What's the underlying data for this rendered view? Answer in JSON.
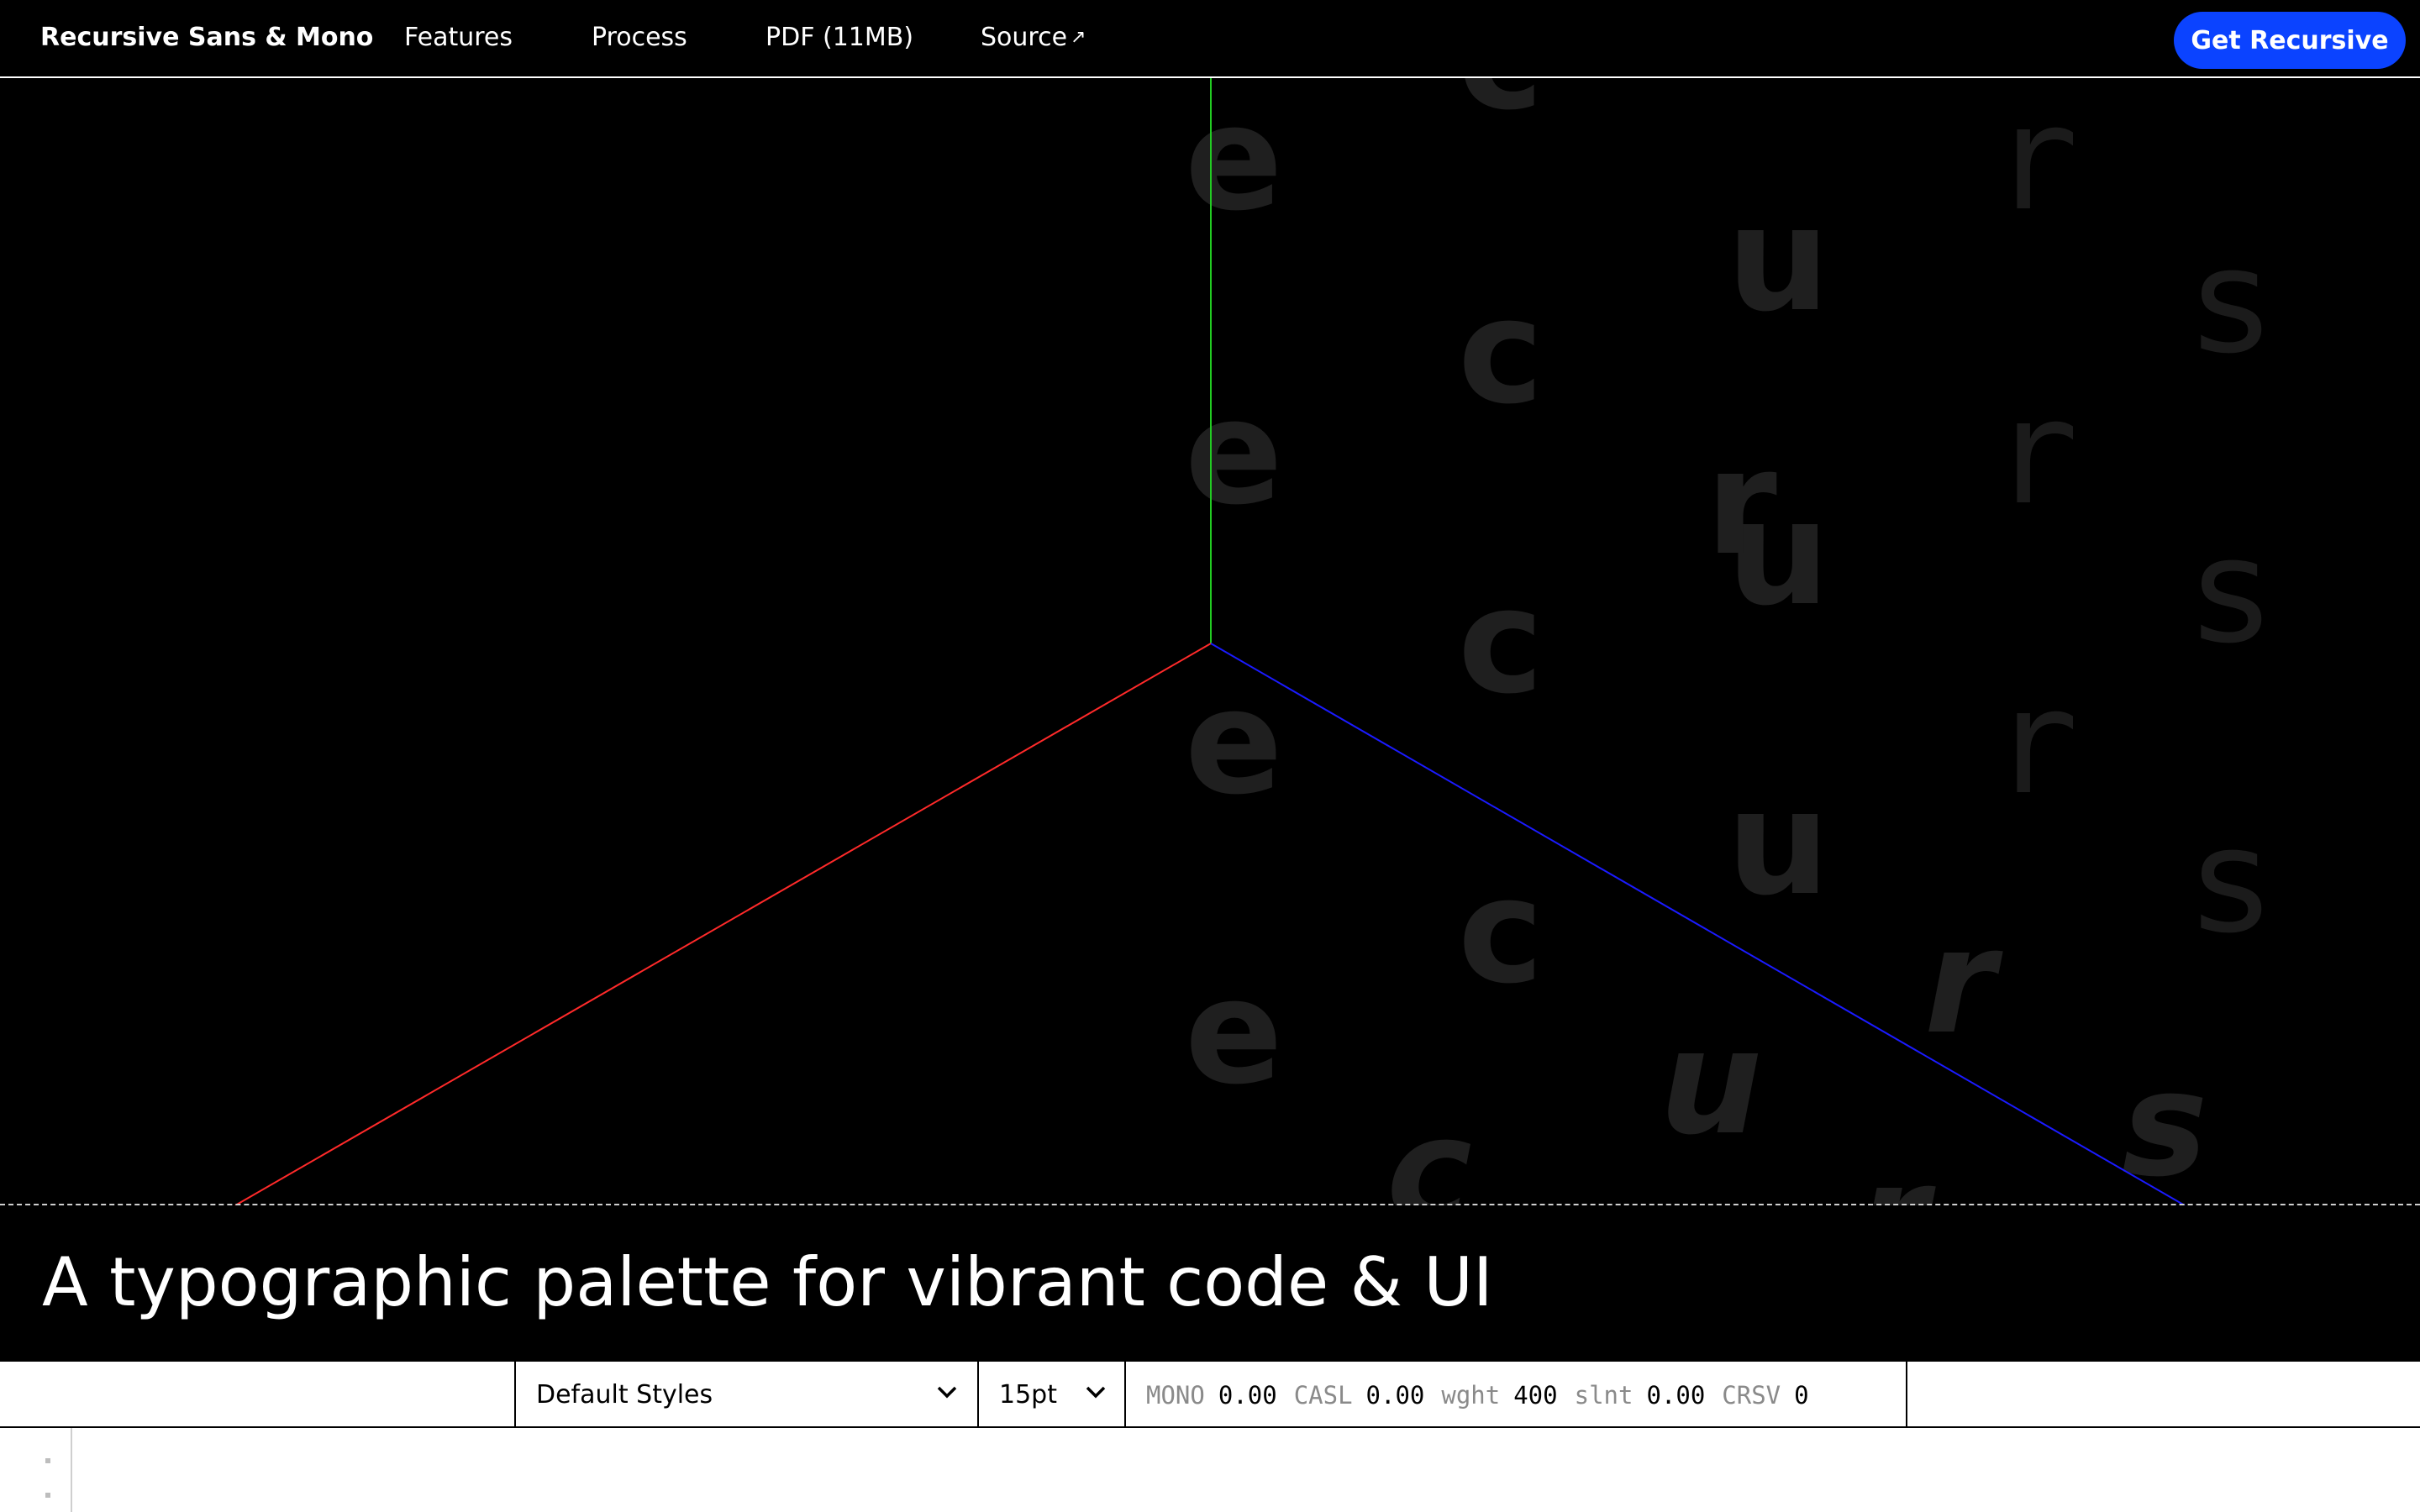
{
  "nav": {
    "brand": "Recursive Sans & Mono",
    "links": [
      {
        "label": "Features"
      },
      {
        "label": "Process"
      },
      {
        "label": "PDF (11MB)"
      },
      {
        "label": "Source",
        "icon": "external-link-arrow-icon"
      }
    ],
    "cta_label": "Get Recursive",
    "cta_color": "#0b43ff"
  },
  "hero": {
    "background_letters": [
      "e",
      "c",
      "u",
      "r",
      "s"
    ],
    "axis_colors": {
      "x": "#ff2a2a",
      "y": "#22cc22",
      "z": "#1a1aff"
    },
    "headline": "A typographic palette for vibrant code & UI"
  },
  "toolbar": {
    "style_select": {
      "value": "Default Styles",
      "icon": "chevron-down-icon"
    },
    "size_select": {
      "value": "15pt",
      "icon": "chevron-down-icon"
    },
    "axes": [
      {
        "name": "MONO",
        "value": "0.00"
      },
      {
        "name": "CASL",
        "value": "0.00"
      },
      {
        "name": "wght",
        "value": "400"
      },
      {
        "name": "slnt",
        "value": "0.00"
      },
      {
        "name": "CRSV",
        "value": "0"
      }
    ]
  }
}
